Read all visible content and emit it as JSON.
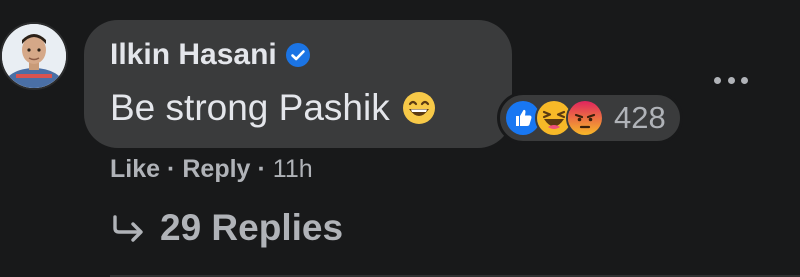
{
  "comment": {
    "author": "Ilkin Hasani",
    "verified": true,
    "text": "Be strong Pashik",
    "text_emoji": "grinning-smiling-eyes-emoji"
  },
  "reactions": {
    "types": [
      "like-reaction-icon",
      "haha-reaction-icon",
      "angry-reaction-icon"
    ],
    "count": "428"
  },
  "actions": {
    "like_label": "Like",
    "separator": "·",
    "reply_label": "Reply",
    "timestamp": "11h"
  },
  "replies": {
    "label": "29 Replies"
  },
  "colors": {
    "background": "#18191a",
    "bubble": "#3a3b3c",
    "primary_text": "#e4e6eb",
    "secondary_text": "#b0b3b8",
    "like_blue": "#1877f2",
    "verified_blue": "#1b74e4",
    "haha_yellow": "#f7b928",
    "angry_red": "#e9710f"
  }
}
